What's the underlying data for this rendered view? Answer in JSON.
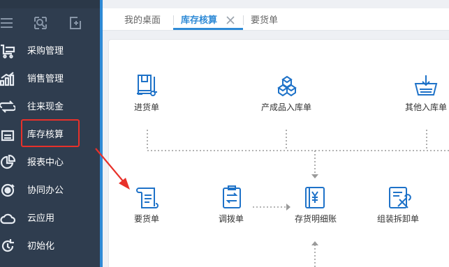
{
  "sidebar": {
    "tools": [
      {
        "icon": "menu-icon"
      },
      {
        "icon": "search-icon"
      },
      {
        "icon": "new-document-icon"
      }
    ],
    "items": [
      {
        "label": "采购管理",
        "icon": "cart-icon"
      },
      {
        "label": "销售管理",
        "icon": "bar-chart-icon"
      },
      {
        "label": "往来现金",
        "icon": "exchange-icon"
      },
      {
        "label": "库存核算",
        "icon": "warehouse-icon"
      },
      {
        "label": "报表中心",
        "icon": "pie-chart-icon"
      },
      {
        "label": "协同办公",
        "icon": "collaboration-icon"
      },
      {
        "label": "云应用",
        "icon": "cloud-icon"
      },
      {
        "label": "初始化",
        "icon": "refresh-icon"
      }
    ]
  },
  "tabs": [
    {
      "label": "我的桌面",
      "active": false
    },
    {
      "label": "库存核算",
      "active": true
    },
    {
      "label": "要货单",
      "active": false
    }
  ],
  "flow": {
    "top_row": [
      {
        "label": "进货单",
        "icon": "purchase-receipt-icon"
      },
      {
        "label": "产成品入库单",
        "icon": "product-boxes-icon"
      },
      {
        "label": "其他入库单",
        "icon": "inbound-basket-icon"
      }
    ],
    "bottom_row": [
      {
        "label": "要货单",
        "icon": "requisition-scroll-icon"
      },
      {
        "label": "调拨单",
        "icon": "transfer-clipboard-icon"
      },
      {
        "label": "存货明细账",
        "icon": "inventory-ledger-icon"
      },
      {
        "label": "组装拆卸单",
        "icon": "assembly-tools-icon"
      }
    ]
  },
  "colors": {
    "sidebar_bg": "#2f3d4f",
    "accent": "#2e8ad6",
    "highlight_red": "#e8312a",
    "icon_blue": "#1e72c8"
  }
}
